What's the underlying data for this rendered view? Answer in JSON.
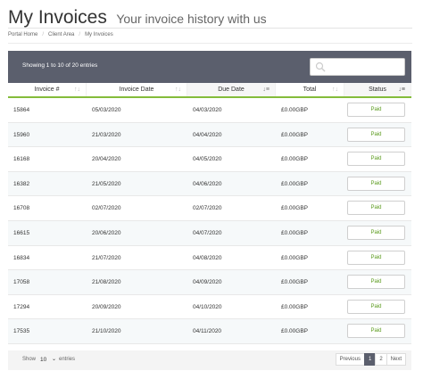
{
  "header": {
    "title": "My Invoices",
    "subtitle": "Your invoice history with us"
  },
  "breadcrumb": [
    "Portal Home",
    "Client Area",
    "My Invoices"
  ],
  "table": {
    "info": "Showing 1 to 10 of 20 entries",
    "search_placeholder": "",
    "columns": [
      "Invoice #",
      "Invoice Date",
      "Due Date",
      "Total",
      "Status"
    ],
    "rows": [
      [
        "15864",
        "05/03/2020",
        "04/03/2020",
        "£0.00GBP",
        "Paid"
      ],
      [
        "15960",
        "21/03/2020",
        "04/04/2020",
        "£0.00GBP",
        "Paid"
      ],
      [
        "16168",
        "20/04/2020",
        "04/05/2020",
        "£0.00GBP",
        "Paid"
      ],
      [
        "16382",
        "21/05/2020",
        "04/06/2020",
        "£0.00GBP",
        "Paid"
      ],
      [
        "16708",
        "02/07/2020",
        "02/07/2020",
        "£0.00GBP",
        "Paid"
      ],
      [
        "16615",
        "20/06/2020",
        "04/07/2020",
        "£0.00GBP",
        "Paid"
      ],
      [
        "16834",
        "21/07/2020",
        "04/08/2020",
        "£0.00GBP",
        "Paid"
      ],
      [
        "17058",
        "21/08/2020",
        "04/09/2020",
        "£0.00GBP",
        "Paid"
      ],
      [
        "17294",
        "20/09/2020",
        "04/10/2020",
        "£0.00GBP",
        "Paid"
      ],
      [
        "17535",
        "21/10/2020",
        "04/11/2020",
        "£0.00GBP",
        "Paid"
      ]
    ],
    "status_color": "#5a9a1c",
    "accent_color": "#84bc3b",
    "toolbar_color": "#5b5f6d"
  },
  "footer": {
    "show_label": "Show",
    "length_value": "10",
    "entries_label": "entries",
    "pager": {
      "previous": "Previous",
      "pages": [
        "1",
        "2"
      ],
      "next": "Next",
      "current": "1"
    }
  },
  "icons": {
    "search": "search-icon",
    "sort": "sort-icon",
    "chevron": "chevron-down-icon"
  }
}
